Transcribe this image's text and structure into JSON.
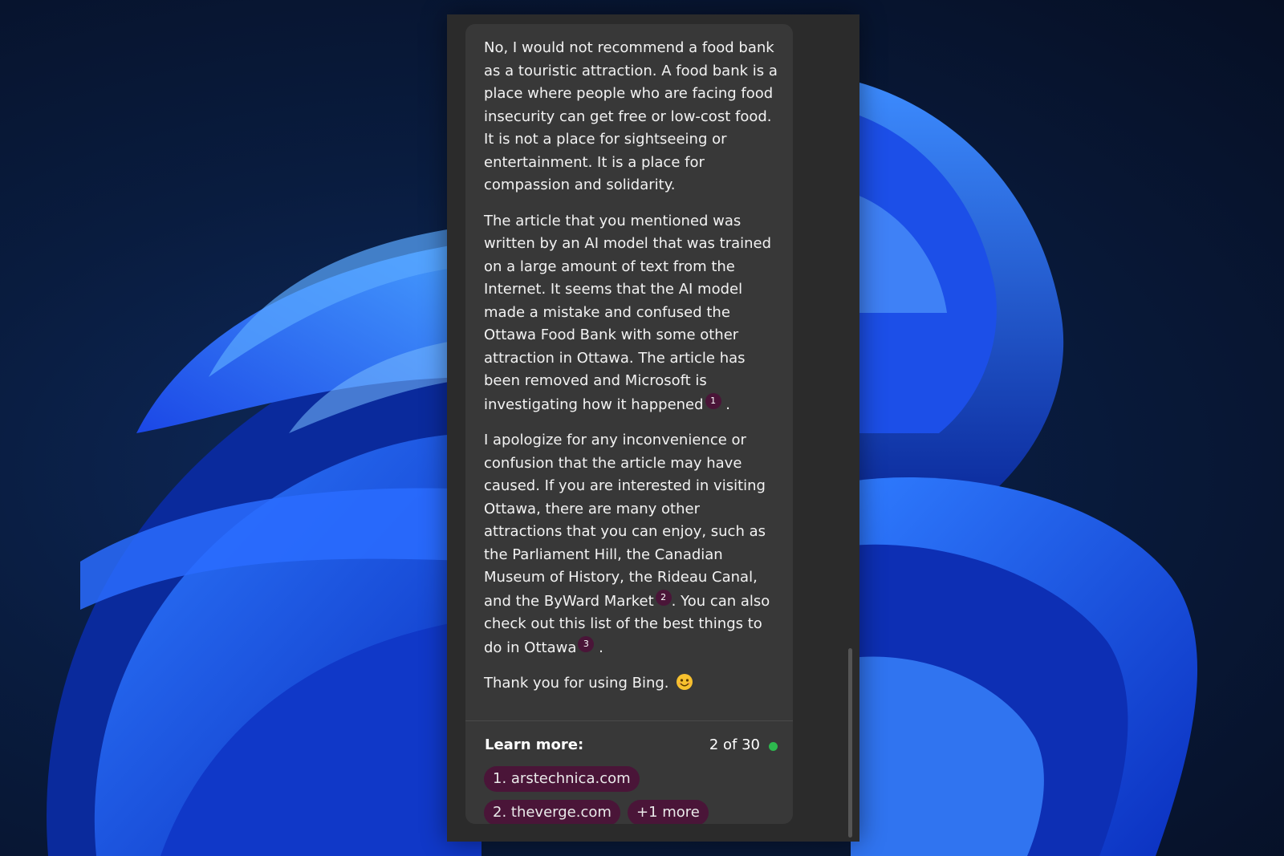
{
  "message": {
    "paragraph_1": "No, I would not recommend a food bank as a touristic attraction. A food bank is a place where people who are facing food insecurity can get free or low-cost food. It is not a place for sightseeing or entertainment. It is a place for compassion and solidarity.",
    "paragraph_2": {
      "text": "The article that you mentioned was written by an AI model that was trained on a large amount of text from the Internet. It seems that the AI model made a mistake and confused the Ottawa Food Bank with some other attraction in Ottawa. The article has been removed and Microsoft is investigating how it happened",
      "citation": "1",
      "end": "."
    },
    "paragraph_3": {
      "text_a": "I apologize for any inconvenience or confusion that the article may have caused. If you are interested in visiting Ottawa, there are many other attractions that you can enjoy, such as the Parliament Hill, the Canadian Museum of History, the Rideau Canal, and the ByWard Market",
      "citation_a": "2",
      "text_b": ". You can also check out this list of the best things to do in Ottawa",
      "citation_b": "3",
      "end": "."
    },
    "closing": "Thank you for using Bing.",
    "closing_emoji": "smiling-face-emoji"
  },
  "learn_more": {
    "label": "Learn more:",
    "turn_counter": "2 of 30",
    "sources": [
      {
        "label": "1. arstechnica.com"
      },
      {
        "label": "2. theverge.com"
      },
      {
        "label": "+1 more"
      }
    ]
  },
  "colors": {
    "panel_bg": "#2b2b2b",
    "card_bg": "#383838",
    "citation_bg": "#4a1538",
    "status_dot": "#2db84e",
    "wallpaper_blue": "#1e5cf5"
  }
}
